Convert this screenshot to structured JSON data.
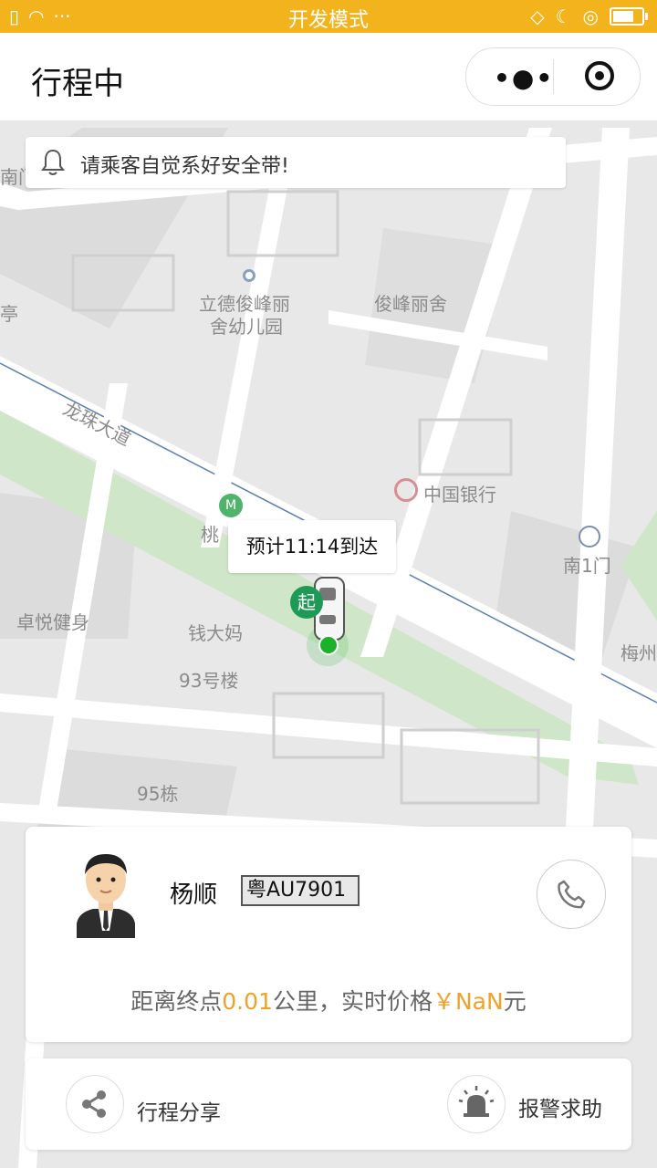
{
  "status_bar": {
    "title": "开发模式"
  },
  "nav": {
    "title": "行程中",
    "more_glyph": "•●•"
  },
  "map": {
    "labels": [
      {
        "text": "立德俊峰丽"
      },
      {
        "text": "舍幼儿园"
      },
      {
        "text": "俊峰丽舍"
      },
      {
        "text": "龙珠大道"
      },
      {
        "text": "中国银行"
      },
      {
        "text": "桃"
      },
      {
        "text": "南1门"
      },
      {
        "text": "卓悦健身"
      },
      {
        "text": "钱大妈"
      },
      {
        "text": "93号楼"
      },
      {
        "text": "95栋"
      },
      {
        "text": "梅州"
      },
      {
        "text": "亭"
      },
      {
        "text": "南门"
      }
    ]
  },
  "notice": {
    "text": "请乘客自觉系好安全带!"
  },
  "eta": {
    "text": "预计11:14到达"
  },
  "marker": {
    "start_label": "起"
  },
  "driver": {
    "name": "杨顺",
    "plate": "粤AU7901",
    "trip_prefix": "距离终点",
    "distance": "0.01",
    "trip_mid": "公里，实时价格",
    "price": "￥NaN",
    "trip_suffix": "元"
  },
  "actions": {
    "share_label": "行程分享",
    "alarm_label": "报警求助"
  },
  "colors": {
    "status_bar": "#f3b31c",
    "accent": "#f0a127",
    "start_marker": "#1d9a55"
  }
}
